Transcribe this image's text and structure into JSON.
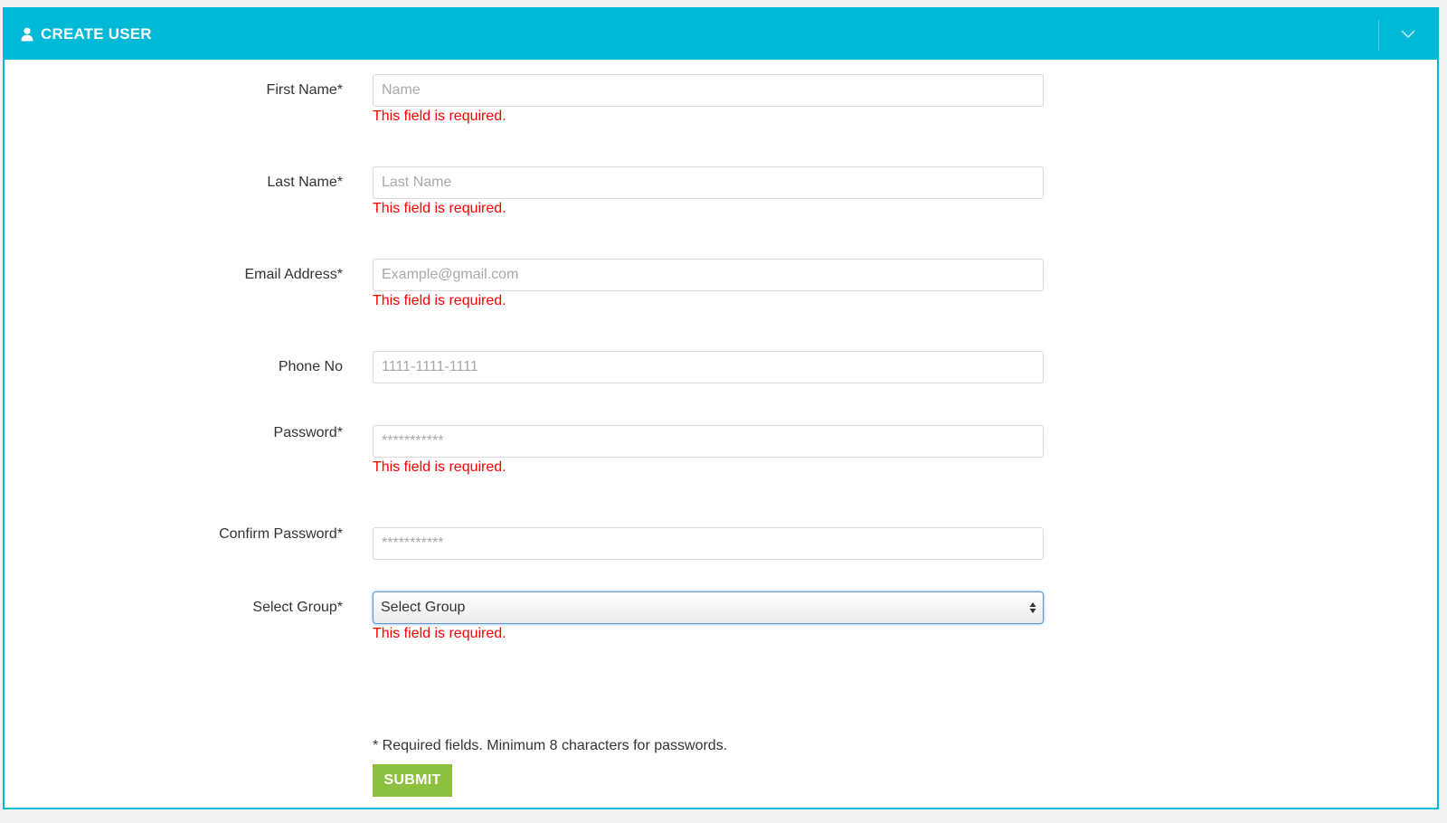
{
  "header": {
    "title": "CREATE USER",
    "icon": "user-icon",
    "collapse_icon": "chevron-down-icon",
    "color": "#00b9d6"
  },
  "form": {
    "fields": [
      {
        "label": "First Name*",
        "placeholder": "Name",
        "value": "",
        "error": "This field is required."
      },
      {
        "label": "Last Name*",
        "placeholder": "Last Name",
        "value": "",
        "error": "This field is required."
      },
      {
        "label": "Email Address*",
        "placeholder": "Example@gmail.com",
        "value": "",
        "error": "This field is required."
      },
      {
        "label": "Phone No",
        "placeholder": "1111-1111-1111",
        "value": "",
        "error": ""
      },
      {
        "label": "Password*",
        "placeholder": "***********",
        "value": "",
        "error": "This field is required."
      },
      {
        "label": "Confirm Password*",
        "placeholder": "***********",
        "value": "",
        "error": ""
      }
    ],
    "group": {
      "label": "Select Group*",
      "selected": "Select Group",
      "error": "This field is required."
    },
    "note": "* Required fields. Minimum 8 characters for passwords.",
    "submit_label": "SUBMIT",
    "submit_color": "#8dc03f",
    "error_color": "#ff0000"
  }
}
